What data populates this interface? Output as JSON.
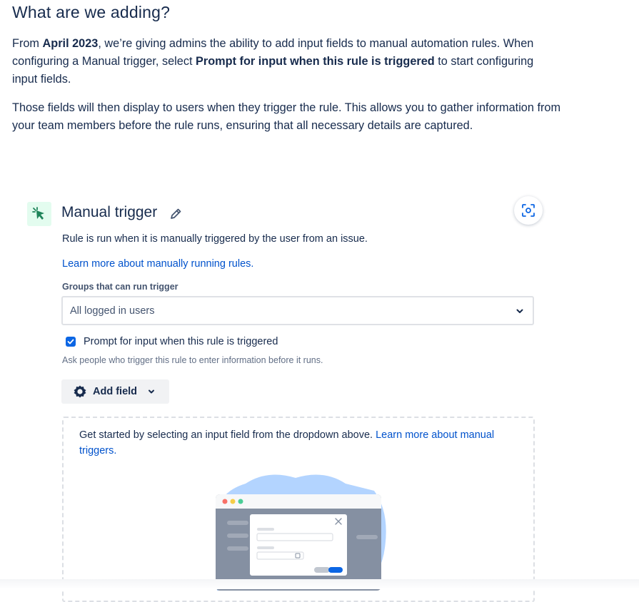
{
  "heading": "What are we adding?",
  "intro": {
    "p1_a": "From ",
    "p1_date": "April 2023",
    "p1_b": ", we’re giving admins the ability to add input fields to manual automation rules. When configuring a Manual trigger, select ",
    "p1_option": "Prompt for input when this rule is triggered",
    "p1_c": " to start configuring input fields.",
    "p2": "Those fields will then display to users when they trigger the rule. This allows you to gather information from your team members before the rule runs, ensuring that all necessary details are captured."
  },
  "trigger": {
    "icon": "cursor-click-icon",
    "title": "Manual trigger",
    "description": "Rule is run when it is manually triggered by the user from an issue.",
    "learn_more": "Learn more about manually running rules.",
    "groups_label": "Groups that can run trigger",
    "groups_value": "All logged in users",
    "prompt_label": "Prompt for input when this rule is triggered",
    "prompt_checked": true,
    "prompt_hint": "Ask people who trigger this rule to enter information before it runs.",
    "add_field_label": "Add field",
    "empty_text": "Get started by selecting an input field from the dropdown above. ",
    "empty_link": "Learn more about manual triggers."
  },
  "colors": {
    "text": "#172b4d",
    "link": "#0052cc",
    "checkbox": "#0c66e4",
    "icon_bg": "#e3fcef",
    "icon_fg": "#1f845a",
    "illustration_blob": "#b3d4ff"
  }
}
